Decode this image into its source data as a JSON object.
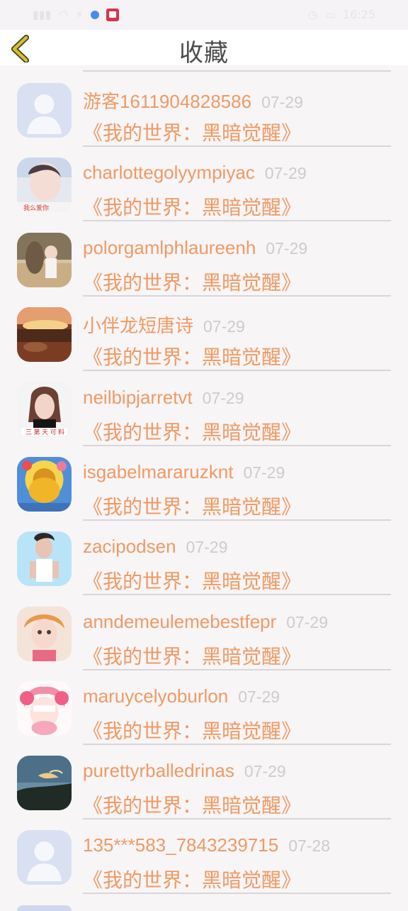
{
  "status_bar": {
    "time": "16:25"
  },
  "header": {
    "title": "收藏"
  },
  "items": [
    {
      "name": "游客1611904828586",
      "date": "07-29",
      "book": "《我的世界：黑暗觉醒》",
      "avatar": "default-avatar"
    },
    {
      "name": "charlottegolyympiyac",
      "date": "07-29",
      "book": "《我的世界：黑暗觉醒》",
      "avatar": "photo-avatar"
    },
    {
      "name": "polorgamlphlaureenh",
      "date": "07-29",
      "book": "《我的世界：黑暗觉醒》",
      "avatar": "photo-avatar"
    },
    {
      "name": "小伴龙短唐诗",
      "date": "07-29",
      "book": "《我的世界：黑暗觉醒》",
      "avatar": "photo-avatar"
    },
    {
      "name": "neilbipjarretvt",
      "date": "07-29",
      "book": "《我的世界：黑暗觉醒》",
      "avatar": "photo-avatar"
    },
    {
      "name": "isgabelmararuzknt",
      "date": "07-29",
      "book": "《我的世界：黑暗觉醒》",
      "avatar": "photo-avatar"
    },
    {
      "name": "zacipodsen",
      "date": "07-29",
      "book": "《我的世界：黑暗觉醒》",
      "avatar": "photo-avatar"
    },
    {
      "name": "anndemeulemebestfepr",
      "date": "07-29",
      "book": "《我的世界：黑暗觉醒》",
      "avatar": "photo-avatar"
    },
    {
      "name": "maruycelyoburlon",
      "date": "07-29",
      "book": "《我的世界：黑暗觉醒》",
      "avatar": "photo-avatar"
    },
    {
      "name": "purettyrballedrinas",
      "date": "07-29",
      "book": "《我的世界：黑暗觉醒》",
      "avatar": "photo-avatar"
    },
    {
      "name": "135***583_7843239715",
      "date": "07-28",
      "book": "《我的世界：黑暗觉醒》",
      "avatar": "default-avatar"
    }
  ],
  "colors": {
    "accent": "#ef9a63",
    "date": "#cfcbcb",
    "title": "#4b4b4b",
    "back_icon": "#d8c11f"
  }
}
